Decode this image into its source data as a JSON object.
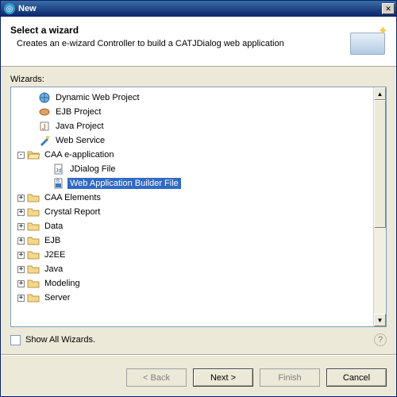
{
  "window": {
    "title": "New"
  },
  "banner": {
    "heading": "Select a wizard",
    "description": "Creates an e-wizard Controller to build a CATJDialog web application"
  },
  "treeLabel": "Wizards:",
  "tree": {
    "dynWeb": "Dynamic Web Project",
    "ejbProj": "EJB Project",
    "javaProj": "Java Project",
    "webSvc": "Web Service",
    "caaEapp": "CAA e-application",
    "jdialog": "JDialog File",
    "wabFile": "Web Application Builder File",
    "caaElem": "CAA Elements",
    "crystal": "Crystal Report",
    "data": "Data",
    "ejb": "EJB",
    "j2ee": "J2EE",
    "java": "Java",
    "modeling": "Modeling",
    "server": "Server"
  },
  "showAllLabel": "Show All Wizards.",
  "buttons": {
    "back": "< Back",
    "next": "Next >",
    "finish": "Finish",
    "cancel": "Cancel"
  }
}
